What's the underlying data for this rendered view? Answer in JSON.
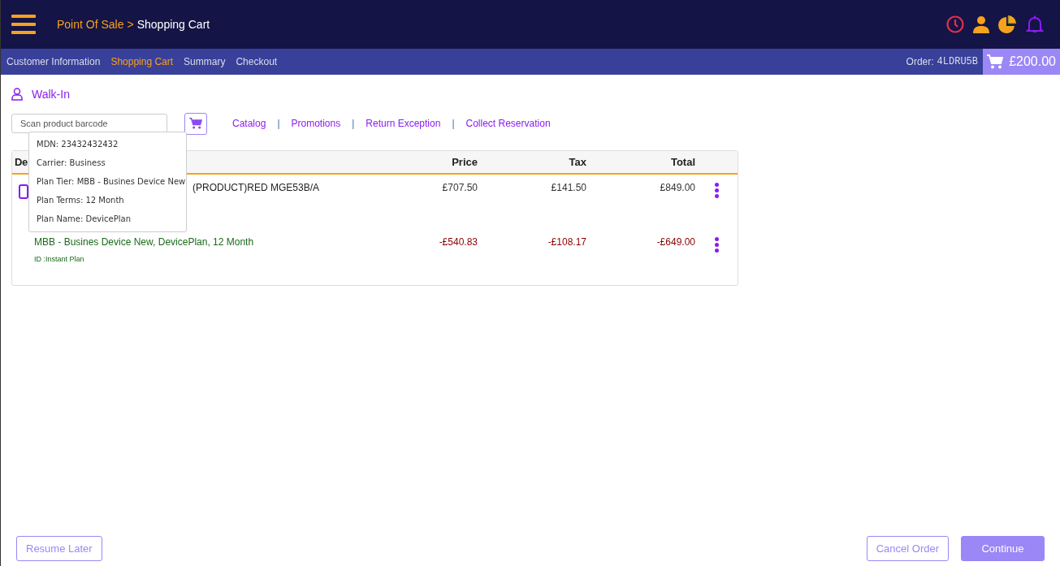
{
  "header": {
    "breadcrumb": [
      {
        "label": "Point Of Sale",
        "current": false
      },
      {
        "label": ">",
        "current": false
      },
      {
        "label": "Shopping Cart",
        "current": true
      }
    ]
  },
  "steps": [
    {
      "label": "Customer Information",
      "selected": false
    },
    {
      "label": "Shopping Cart",
      "selected": true
    },
    {
      "label": "Summary",
      "selected": false
    },
    {
      "label": "Checkout",
      "selected": false
    }
  ],
  "order": {
    "label": "Order:",
    "code": "4LDRU5B",
    "cart_total": "£200.00"
  },
  "customer": {
    "name": "Walk-In"
  },
  "scan": {
    "placeholder": "Scan product barcode"
  },
  "links": [
    {
      "label": "Catalog"
    },
    {
      "separator": "|",
      "label": "Promotions"
    },
    {
      "separator": "|",
      "label": "Return Exception"
    },
    {
      "separator": "|",
      "label": "Collect Reservation"
    }
  ],
  "table": {
    "columns": [
      "De",
      "Price",
      "Tax",
      "Total"
    ],
    "rows": [
      {
        "kind": "product",
        "description": "(PRODUCT)RED MGE53B/A",
        "price": "£707.50",
        "tax": "£141.50",
        "total": "£849.00"
      },
      {
        "kind": "plan",
        "description": "MBB - Busines Device New, DevicePlan, 12 Month",
        "subtitle": "ID :Instant Plan",
        "price": "-£540.83",
        "tax": "-£108.17",
        "total": "-£649.00"
      }
    ]
  },
  "tooltip": {
    "lines": [
      "MDN: 23432432432",
      "Carrier: Business",
      "Plan Tier: MBB - Busines Device New",
      "Plan Terms: 12 Month",
      "Plan Name: DevicePlan"
    ]
  },
  "footer": {
    "left": [
      "Resume Later"
    ],
    "right": [
      {
        "label": "Cancel Order",
        "primary": false
      },
      {
        "label": "Continue",
        "primary": true
      }
    ]
  }
}
